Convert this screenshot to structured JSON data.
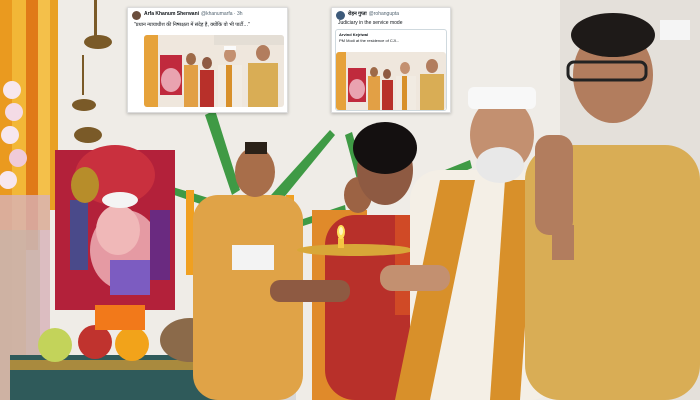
{
  "tweets": [
    {
      "user": "Arfa Khanum Sherwani",
      "handle": "@khanumarfa · 3h",
      "text": "\"प्रधान न्यायाधीश की निष्पक्षता में संदेह है, क्योंकि वो भी पार्टी…\"",
      "image_icon": "ganesh-puja-photo-icon"
    },
    {
      "user": "रोहन गुप्ता",
      "handle": "@rohangupta",
      "text": "Judiciary in the service mode",
      "quote": {
        "user": "Arvind Kejriwal",
        "text": "PM Modi at the residence of CJI...",
        "image_icon": "ganesh-puja-photo-icon"
      }
    }
  ],
  "colors": {
    "saffron": "#e8a33c",
    "kurta_yellow": "#d9ad55",
    "marigold": "#f0a020",
    "saree_red": "#b8302a",
    "wall": "#ece9e4",
    "tweet_bg": "#ffffff"
  }
}
